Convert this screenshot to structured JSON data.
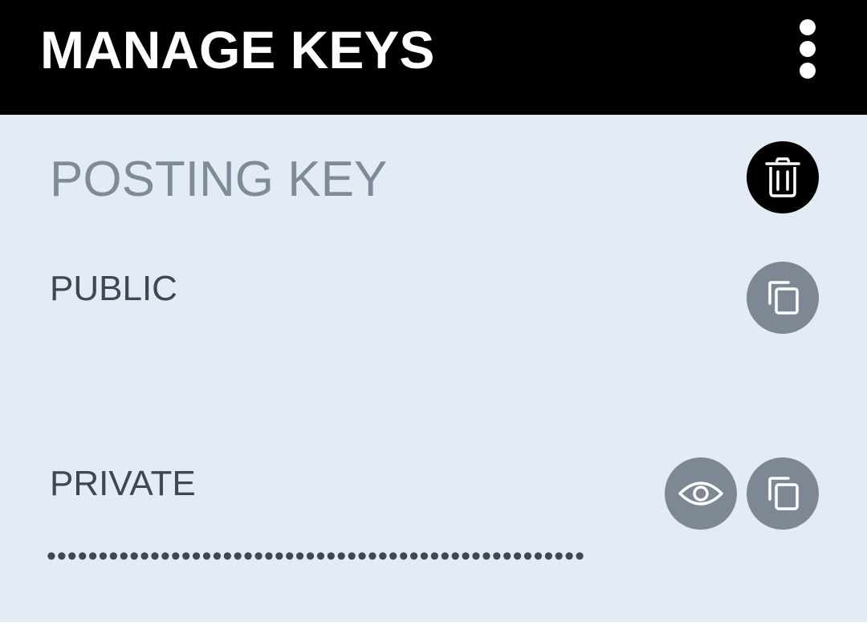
{
  "header": {
    "title": "MANAGE KEYS",
    "menu_icon": "more-vertical-icon"
  },
  "key_card": {
    "title": "POSTING KEY",
    "delete_icon": "trash-icon",
    "public": {
      "label": "PUBLIC",
      "value": "",
      "copy_icon": "copy-icon"
    },
    "private": {
      "label": "PRIVATE",
      "masked_value": "••••••••••••••••••••••••••••••••••••••••••••••••••••",
      "reveal_icon": "eye-icon",
      "copy_icon": "copy-icon"
    }
  },
  "colors": {
    "header_bg": "#000000",
    "card_bg": "#e3ecf5",
    "title_text": "#7e8b98",
    "label_text": "#3f4750",
    "button_grey": "#7d8894",
    "button_dark": "#000000"
  }
}
